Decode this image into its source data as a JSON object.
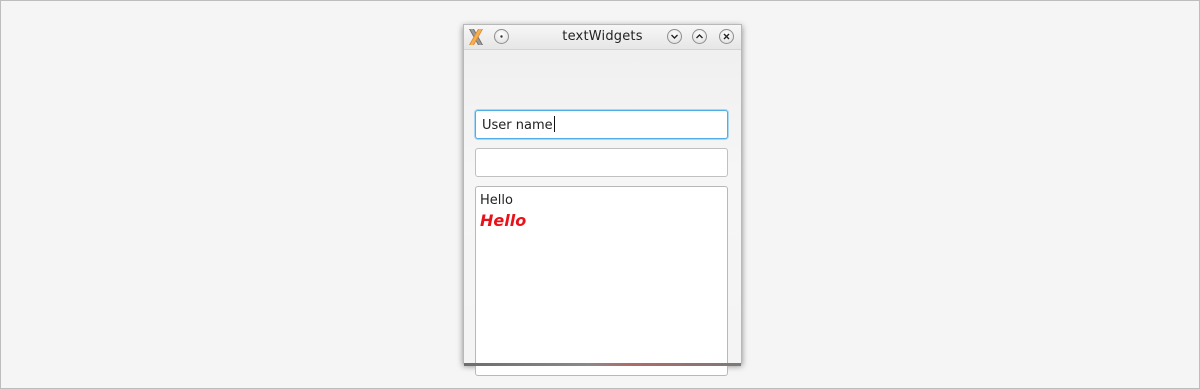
{
  "window": {
    "title": "textWidgets"
  },
  "titlebar_icons": {
    "app": "x-app-icon",
    "menu": "window-menu-icon",
    "minimize": "chevron-down-icon",
    "maximize": "chevron-up-icon",
    "close": "close-icon"
  },
  "username_field": {
    "value": "User name"
  },
  "password_field": {
    "value": ""
  },
  "text_edit": {
    "plain_line": "Hello",
    "styled_line": "Hello",
    "styled_color": "#e8121b"
  },
  "colors": {
    "focus_border": "#4faee8",
    "desktop_background": "#f5f5f5"
  }
}
